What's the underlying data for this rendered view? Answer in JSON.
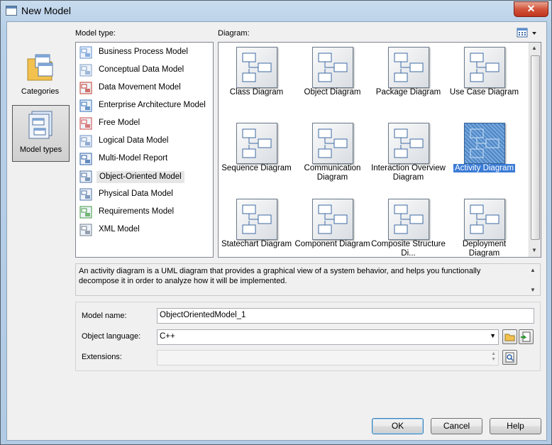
{
  "window": {
    "title": "New Model",
    "close_symbol": "✕"
  },
  "categories": [
    {
      "label": "Categories",
      "icon": "categories-folder-icon"
    },
    {
      "label": "Model types",
      "icon": "model-types-icon",
      "selected": true
    }
  ],
  "labels": {
    "model_type": "Model type:",
    "diagram": "Diagram:"
  },
  "model_types": [
    {
      "label": "Business Process Model",
      "icon": "business-process-model-icon"
    },
    {
      "label": "Conceptual Data Model",
      "icon": "conceptual-data-model-icon"
    },
    {
      "label": "Data Movement Model",
      "icon": "data-movement-model-icon"
    },
    {
      "label": "Enterprise Architecture Model",
      "icon": "enterprise-architecture-model-icon"
    },
    {
      "label": "Free Model",
      "icon": "free-model-icon"
    },
    {
      "label": "Logical Data Model",
      "icon": "logical-data-model-icon"
    },
    {
      "label": "Multi-Model Report",
      "icon": "multi-model-report-icon"
    },
    {
      "label": "Object-Oriented Model",
      "icon": "object-oriented-model-icon",
      "selected": true
    },
    {
      "label": "Physical Data Model",
      "icon": "physical-data-model-icon"
    },
    {
      "label": "Requirements Model",
      "icon": "requirements-model-icon"
    },
    {
      "label": "XML Model",
      "icon": "xml-model-icon"
    }
  ],
  "diagrams": [
    {
      "label": "Class Diagram",
      "icon": "class-diagram-icon"
    },
    {
      "label": "Object Diagram",
      "icon": "object-diagram-icon"
    },
    {
      "label": "Package Diagram",
      "icon": "package-diagram-icon"
    },
    {
      "label": "Use Case Diagram",
      "icon": "use-case-diagram-icon"
    },
    {
      "label": "Sequence Diagram",
      "icon": "sequence-diagram-icon"
    },
    {
      "label": "Communication Diagram",
      "icon": "communication-diagram-icon"
    },
    {
      "label": "Interaction Overview Diagram",
      "icon": "interaction-overview-diagram-icon"
    },
    {
      "label": "Activity Diagram",
      "icon": "activity-diagram-icon",
      "selected": true
    },
    {
      "label": "Statechart Diagram",
      "icon": "statechart-diagram-icon"
    },
    {
      "label": "Component Diagram",
      "icon": "component-diagram-icon"
    },
    {
      "label": "Composite Structure Di...",
      "icon": "composite-structure-diagram-icon"
    },
    {
      "label": "Deployment Diagram",
      "icon": "deployment-diagram-icon"
    }
  ],
  "description": "An activity diagram is a UML diagram that provides a graphical view of a system behavior, and helps you functionally decompose it in order to analyze how it will be implemented.",
  "form": {
    "model_name_label": "Model name:",
    "model_name_value": "ObjectOrientedModel_1",
    "object_language_label": "Object language:",
    "object_language_value": "C++",
    "extensions_label": "Extensions:",
    "extensions_value": ""
  },
  "buttons": {
    "ok": "OK",
    "cancel": "Cancel",
    "help": "Help"
  },
  "colors": {
    "selection": "#3a7bd5",
    "title_bar": "#b7cfe7",
    "close_button": "#c0351d"
  }
}
